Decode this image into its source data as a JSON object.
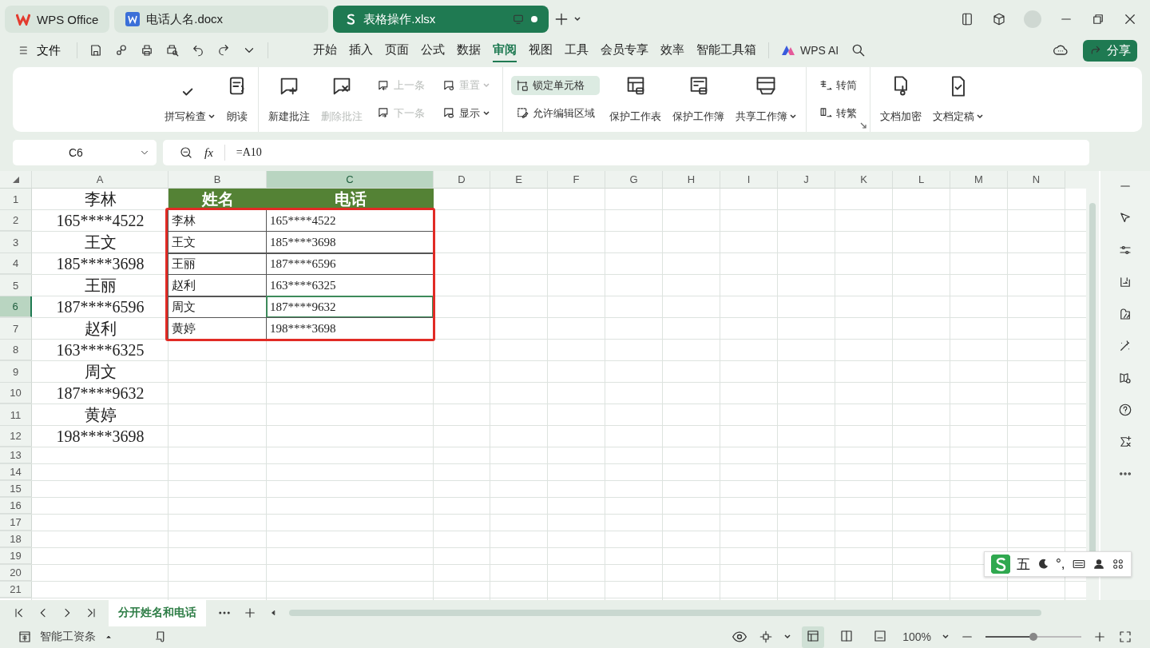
{
  "window_tabs": [
    {
      "kind": "home",
      "label": "WPS Office",
      "selected": false
    },
    {
      "kind": "doc",
      "label": "电话人名.docx",
      "selected": false
    },
    {
      "kind": "sheet",
      "label": "表格操作.xlsx",
      "selected": true
    }
  ],
  "menu": {
    "file": "文件",
    "tabs": [
      {
        "label": "开始",
        "selected": false
      },
      {
        "label": "插入",
        "selected": false
      },
      {
        "label": "页面",
        "selected": false
      },
      {
        "label": "公式",
        "selected": false
      },
      {
        "label": "数据",
        "selected": false
      },
      {
        "label": "审阅",
        "selected": true
      },
      {
        "label": "视图",
        "selected": false
      },
      {
        "label": "工具",
        "selected": false
      },
      {
        "label": "会员专享",
        "selected": false
      },
      {
        "label": "效率",
        "selected": false
      },
      {
        "label": "智能工具箱",
        "selected": false
      }
    ],
    "ai": "WPS AI",
    "share": "分享"
  },
  "ribbon": {
    "groups": [
      {
        "items": [
          {
            "kind": "large",
            "label": "拼写检查",
            "dropdown": true,
            "disabled": false
          },
          {
            "kind": "large",
            "label": "朗读",
            "dropdown": false,
            "disabled": false
          }
        ]
      },
      {
        "items": [
          {
            "kind": "large",
            "label": "新建批注",
            "dropdown": false,
            "disabled": false
          },
          {
            "kind": "large",
            "label": "删除批注",
            "dropdown": false,
            "disabled": true
          },
          {
            "kind": "stack",
            "items": [
              {
                "label": "上一条",
                "dropdown": false,
                "disabled": true,
                "on": false
              },
              {
                "label": "下一条",
                "dropdown": false,
                "disabled": true,
                "on": false
              }
            ]
          },
          {
            "kind": "stack",
            "items": [
              {
                "label": "重置",
                "dropdown": true,
                "disabled": true,
                "on": false
              },
              {
                "label": "显示",
                "dropdown": true,
                "disabled": false,
                "on": false
              }
            ]
          }
        ]
      },
      {
        "items": [
          {
            "kind": "stack",
            "items": [
              {
                "label": "锁定单元格",
                "dropdown": false,
                "disabled": false,
                "on": true
              },
              {
                "label": "允许编辑区域",
                "dropdown": false,
                "disabled": false,
                "on": false
              }
            ]
          },
          {
            "kind": "large",
            "label": "保护工作表",
            "dropdown": false,
            "disabled": false
          },
          {
            "kind": "large",
            "label": "保护工作簿",
            "dropdown": false,
            "disabled": false
          },
          {
            "kind": "large",
            "label": "共享工作簿",
            "dropdown": true,
            "disabled": false
          }
        ]
      },
      {
        "launcher": true,
        "items": [
          {
            "kind": "stack",
            "items": [
              {
                "label": "转简",
                "dropdown": false,
                "disabled": false,
                "on": false
              },
              {
                "label": "转繁",
                "dropdown": false,
                "disabled": false,
                "on": false
              }
            ]
          }
        ]
      },
      {
        "items": [
          {
            "kind": "large",
            "label": "文档加密",
            "dropdown": false,
            "disabled": false
          },
          {
            "kind": "large",
            "label": "文档定稿",
            "dropdown": true,
            "disabled": false
          }
        ]
      }
    ]
  },
  "formula_bar": {
    "name_box": "C6",
    "fx": "fx",
    "formula": "=A10"
  },
  "sheet": {
    "columns": [
      {
        "label": "A",
        "selected": false
      },
      {
        "label": "B",
        "selected": false
      },
      {
        "label": "C",
        "selected": true
      },
      {
        "label": "D",
        "selected": false
      },
      {
        "label": "E",
        "selected": false
      },
      {
        "label": "F",
        "selected": false
      },
      {
        "label": "G",
        "selected": false
      },
      {
        "label": "H",
        "selected": false
      },
      {
        "label": "I",
        "selected": false
      },
      {
        "label": "J",
        "selected": false
      },
      {
        "label": "K",
        "selected": false
      },
      {
        "label": "L",
        "selected": false
      },
      {
        "label": "M",
        "selected": false
      },
      {
        "label": "N",
        "selected": false
      }
    ],
    "rows": [
      {
        "number": "1",
        "selected": false,
        "kind": "header",
        "col_a": "李林",
        "col_b": "姓名",
        "col_c": "电话"
      },
      {
        "number": "2",
        "selected": false,
        "kind": "boxed",
        "col_a": "165****4522",
        "col_b": "李林",
        "col_c": "165****4522"
      },
      {
        "number": "3",
        "selected": false,
        "kind": "boxed",
        "col_a": "王文",
        "col_b": "王文",
        "col_c": "185****3698"
      },
      {
        "number": "4",
        "selected": false,
        "kind": "boxed",
        "col_a": "185****3698",
        "col_b": "王丽",
        "col_c": "187****6596"
      },
      {
        "number": "5",
        "selected": false,
        "kind": "boxed",
        "col_a": "王丽",
        "col_b": "赵利",
        "col_c": "163****6325"
      },
      {
        "number": "6",
        "selected": true,
        "kind": "boxed",
        "col_a": "187****6596",
        "col_b": "周文",
        "col_c": "187****9632"
      },
      {
        "number": "7",
        "selected": false,
        "kind": "boxed",
        "col_a": "赵利",
        "col_b": "黄婷",
        "col_c": "198****3698"
      },
      {
        "number": "8",
        "selected": false,
        "kind": "plain",
        "col_a": "163****6325"
      },
      {
        "number": "9",
        "selected": false,
        "kind": "plain",
        "col_a": "周文"
      },
      {
        "number": "10",
        "selected": false,
        "kind": "plain",
        "col_a": "187****9632"
      },
      {
        "number": "11",
        "selected": false,
        "kind": "plain",
        "col_a": "黄婷"
      },
      {
        "number": "12",
        "selected": false,
        "kind": "plain",
        "col_a": "198****3698"
      },
      {
        "number": "13",
        "selected": false,
        "kind": "short"
      },
      {
        "number": "14",
        "selected": false,
        "kind": "short"
      },
      {
        "number": "15",
        "selected": false,
        "kind": "short"
      },
      {
        "number": "16",
        "selected": false,
        "kind": "short"
      },
      {
        "number": "17",
        "selected": false,
        "kind": "short"
      },
      {
        "number": "18",
        "selected": false,
        "kind": "short"
      },
      {
        "number": "19",
        "selected": false,
        "kind": "short"
      },
      {
        "number": "20",
        "selected": false,
        "kind": "short"
      },
      {
        "number": "21",
        "selected": false,
        "kind": "short"
      }
    ]
  },
  "sheet_tabs": [
    {
      "label": "分开姓名和电话",
      "selected": true
    }
  ],
  "status_bar": {
    "template": "智能工资条",
    "views": [
      {
        "kind": "normal",
        "selected": true
      },
      {
        "kind": "split",
        "selected": false
      },
      {
        "kind": "page",
        "selected": false
      }
    ],
    "zoom": "100%",
    "zoom_slider": {
      "level": 0.5
    }
  },
  "ime_bar": {
    "mode": "五",
    "punct": "°,"
  }
}
